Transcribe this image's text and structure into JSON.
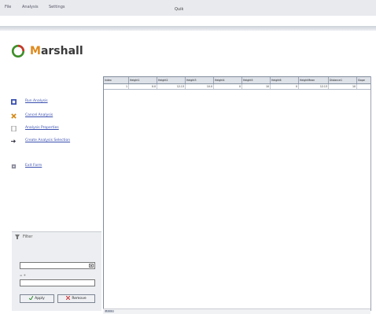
{
  "menubar": {
    "items": [
      "File",
      "Analysis",
      "Settings"
    ],
    "center_tag": "Quik"
  },
  "brand": {
    "first_letter": "M",
    "rest": "arshall"
  },
  "colors": {
    "accent": "#e08a1c",
    "link": "#3a4fb0",
    "logo_green": "#3f8f2a",
    "logo_red": "#c8392b"
  },
  "tasks": [
    {
      "label": "Run Analysis",
      "icon": "run-icon"
    },
    {
      "label": "Cancel Analysis",
      "icon": "cancel-icon"
    },
    {
      "label": "Analysis Properties",
      "icon": "properties-icon"
    },
    {
      "label": "Create Analysis Selection",
      "icon": "selection-icon"
    },
    {
      "label": "Exit Form",
      "icon": "exit-icon"
    }
  ],
  "filter": {
    "title": "Filter",
    "hint": "= +",
    "select_value": "",
    "input_value": "",
    "apply_label": "Apply",
    "remove_label": "Remove"
  },
  "grid": {
    "columns": [
      "Index",
      "Height1",
      "Height2",
      "Height3",
      "Height4",
      "Height5",
      "Height6",
      "HeightMean",
      "Distance1",
      "Slope"
    ],
    "rows": [
      [
        "1",
        "0.0",
        "12.13",
        "10.0",
        "0",
        "10",
        "0",
        "12.13",
        "10",
        ""
      ]
    ],
    "scroll_label": "H 1:1"
  }
}
